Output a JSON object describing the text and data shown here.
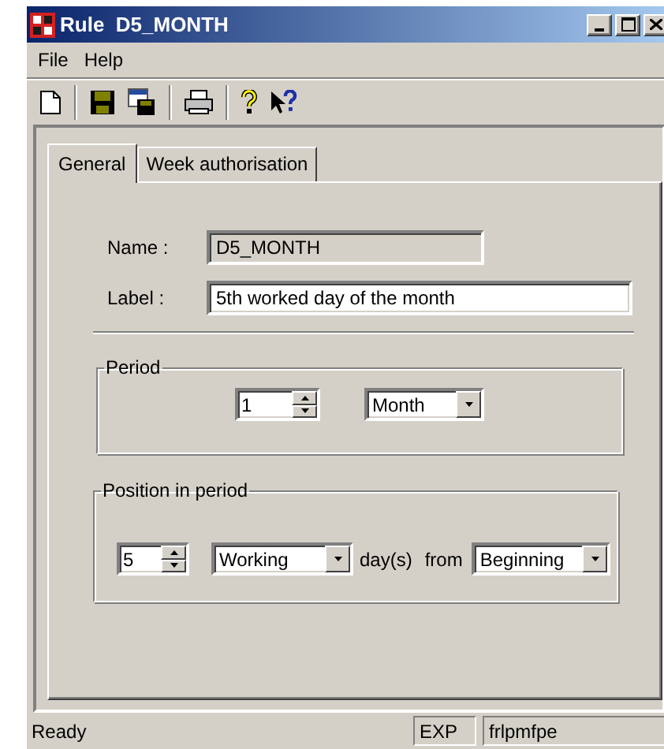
{
  "window": {
    "title": "Rule  D5_MONTH"
  },
  "menu": [
    {
      "label": "File"
    },
    {
      "label": "Help"
    }
  ],
  "tabs": [
    {
      "label": "General",
      "selected": true
    },
    {
      "label": "Week authorisation",
      "selected": false
    }
  ],
  "fields": [
    {
      "label": "Name :",
      "value": "D5_MONTH",
      "disabled": true
    },
    {
      "label": "Label :",
      "value": "5th worked day of the month",
      "disabled": false
    }
  ],
  "period": {
    "title": "Period",
    "count": "1",
    "unit": "Month"
  },
  "position": {
    "title": "Position in period",
    "count": "5",
    "day_type": "Working",
    "days_label": "day(s)",
    "from_label": "from",
    "anchor": "Beginning"
  },
  "status_bar": {
    "message": "Ready",
    "panes": [
      "EXP",
      "frlpmfpe"
    ]
  }
}
